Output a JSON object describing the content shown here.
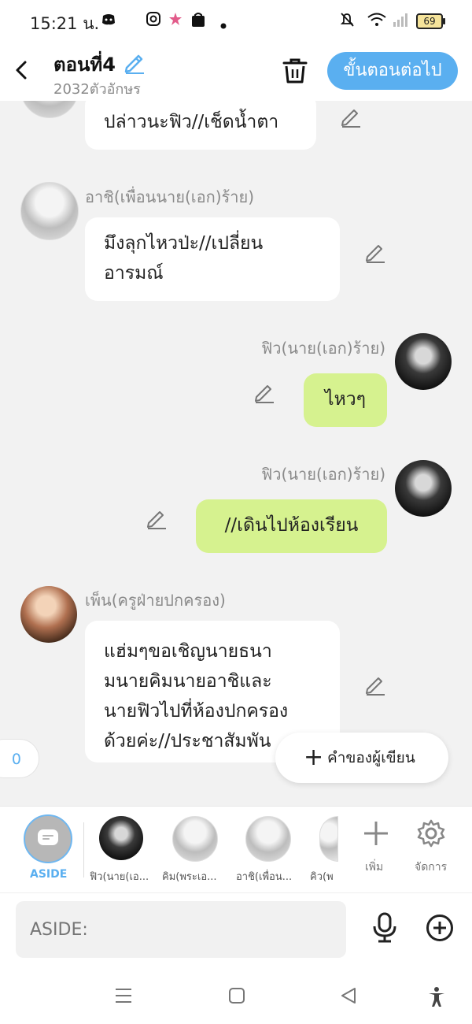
{
  "status": {
    "time": "15:21 น.",
    "battery": "69"
  },
  "header": {
    "back_icon": "back-chevron-icon",
    "title": "ตอนที่4",
    "subtitle": "2032ตัวอักษร",
    "next_label": "ขั้นตอนต่อไป"
  },
  "messages": [
    {
      "text": "ปล่าวนะฟิว//เช็ดน้ำตา",
      "side": "left"
    },
    {
      "name": "อาชิ(เพื่อนนาย(เอก)ร้าย)",
      "text": "มึงลุกไหวป่ะ//เปลี่ยน\nอารมณ์",
      "side": "left"
    },
    {
      "name": "ฟิว(นาย(เอก)ร้าย)",
      "text": "ไหวๆ",
      "side": "right"
    },
    {
      "name": "ฟิว(นาย(เอก)ร้าย)",
      "text": "//เดินไปห้องเรียน",
      "side": "right"
    },
    {
      "name": "เพ็น(ครูฝ่ายปกครอง)",
      "text": "แฮ่มๆขอเชิญนายธนา\nมนายคิมนายอาชิและ\nนายฟิวไปที่ห้องปกครอง\nด้วยค่ะ//ประชาสัมพัน",
      "side": "left"
    }
  ],
  "counter": "0",
  "author_note": "คำของผู้เขียน",
  "strip": {
    "aside_label": "ASIDE",
    "characters": [
      "ฟิว(นาย(เอ...",
      "คิม(พระเอ...",
      "อาชิ(เพื่อน...",
      "คิว(พ"
    ],
    "add_label": "เพิ่ม",
    "manage_label": "จัดการ"
  },
  "input": {
    "placeholder": "ASIDE:"
  },
  "colors": {
    "accent": "#5aaff0",
    "green_bubble": "#d6f28f"
  }
}
